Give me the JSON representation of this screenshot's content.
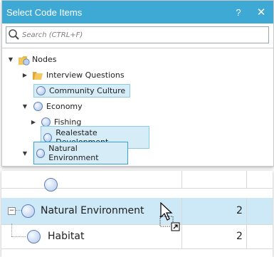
{
  "dialog": {
    "title": "Select Code Items",
    "help_label": "?",
    "close_label": "✕",
    "search_placeholder": "Search (CTRL+F)"
  },
  "tree": {
    "root": "Nodes",
    "items": [
      {
        "label": "Interview Questions"
      },
      {
        "label": "Community Culture"
      },
      {
        "label": "Economy"
      },
      {
        "label": "Fishing"
      },
      {
        "label": "Realestate Development"
      },
      {
        "label": "Natural Environment"
      }
    ]
  },
  "grid": {
    "rows": [
      {
        "name": "Natural Environment",
        "count": "2"
      },
      {
        "name": "Habitat",
        "count": "2"
      }
    ],
    "collapse_symbol": "−"
  },
  "colors": {
    "titlebar": "#3fa9d6",
    "selection": "#d6ecf7",
    "selection_border": "#8ccbe6",
    "grid_highlight": "#cde8f6"
  }
}
